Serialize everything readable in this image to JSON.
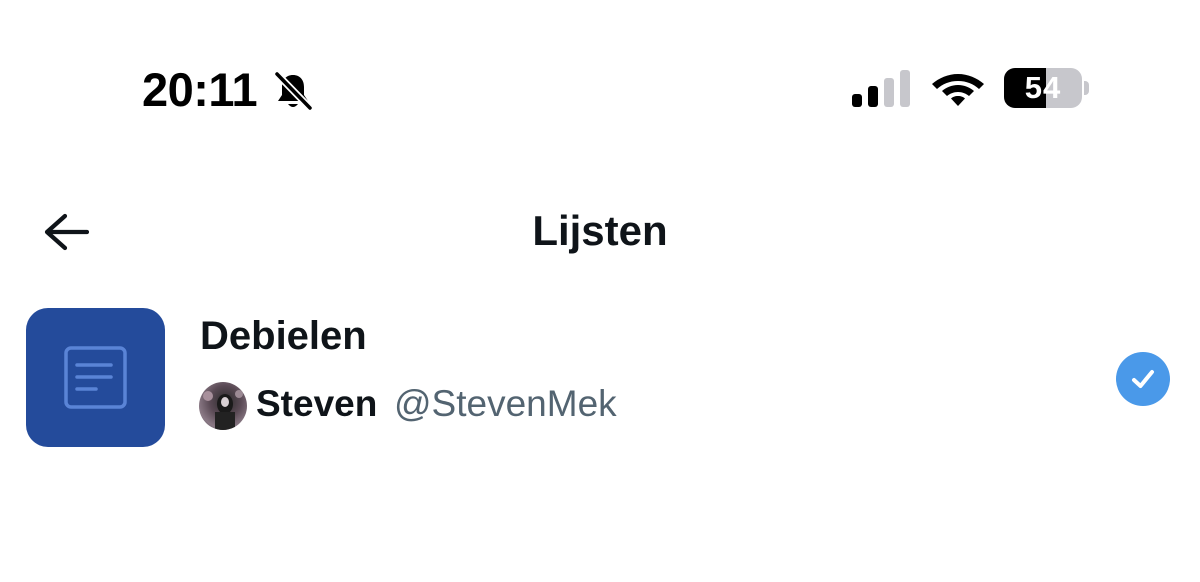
{
  "status_bar": {
    "time": "20:11",
    "battery_percent": "54",
    "battery_level": 0.54,
    "signal_bars_active": 2,
    "signal_bars_total": 4
  },
  "header": {
    "title": "Lijsten"
  },
  "lists": [
    {
      "name": "Debielen",
      "owner_name": "Steven",
      "owner_handle": "@StevenMek",
      "selected": true
    }
  ],
  "colors": {
    "accent": "#4a99e9",
    "list_cover": "#244b9b",
    "text_primary": "#0f1419",
    "text_secondary": "#536471"
  },
  "icons": {
    "mute": "bell-slash-icon",
    "back": "arrow-left-icon",
    "signal": "cellular-signal-icon",
    "wifi": "wifi-icon",
    "list_cover": "list-document-icon",
    "selected": "checkmark-icon"
  }
}
